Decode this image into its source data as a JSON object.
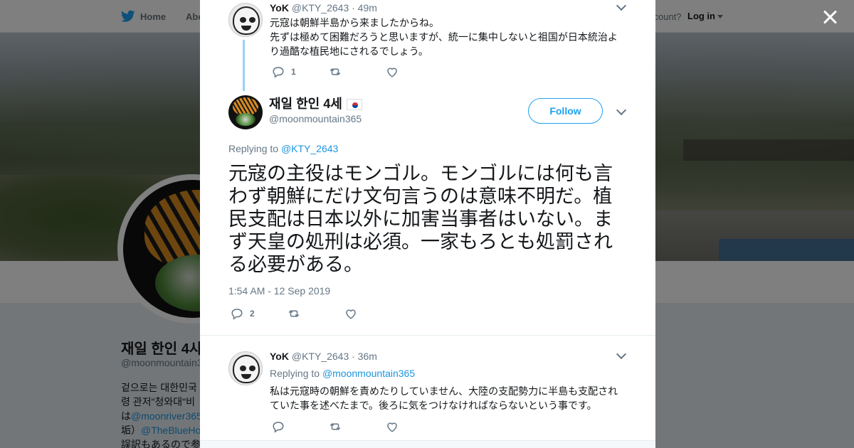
{
  "nav": {
    "home": "Home",
    "about": "Abo",
    "account_prompt": "ccount?",
    "login": "Log in"
  },
  "profile": {
    "name": "재일 한인 4사",
    "handle": "@moonmountain3",
    "bio_line1": "겉으로는 대한민국",
    "bio_line2": "령 관저\"청와대\"비",
    "bio_line3_prefix": "は",
    "bio_line3_link": "@moonriver365",
    "bio_line4_prefix": "垢）",
    "bio_line4_link": "@TheBlueHo",
    "bio_line5": "誤訳もあるので参"
  },
  "modal": {
    "close_label": "×",
    "parent_tweet": {
      "name": "YoK",
      "handle": "@KTY_2643",
      "time": "· 49m",
      "text_line1": "元寇は朝鮮半島から来ましたからね。",
      "text_line2": "先ずは極めて困難だろうと思いますが、統一に集中しないと祖国が日本統治より過酷な植民地にされるでしょう。",
      "reply_count": "1"
    },
    "main_tweet": {
      "name": "재일 한인 4세",
      "handle": "@moonmountain365",
      "follow_label": "Follow",
      "replying_prefix": "Replying to",
      "replying_to": "@KTY_2643",
      "text": "元寇の主役はモンゴル。モンゴルには何も言わず朝鮮にだけ文句言うのは意味不明だ。植民支配は日本以外に加害当事者はいない。まず天皇の処刑は必須。一家もろとも処罰される必要がある。",
      "timestamp": "1:54 AM - 12 Sep 2019",
      "reply_count": "2"
    },
    "reply_tweet": {
      "name": "YoK",
      "handle": "@KTY_2643",
      "time": "· 36m",
      "replying_prefix": "Replying to",
      "replying_to": "@moonmountain365",
      "text": "私は元寇時の朝鮮を責めたりしていません、大陸の支配勢力に半島も支配されていた事を述べたまで。後ろに気をつけなければならないという事です。"
    }
  },
  "icons": {
    "twitter_bird": "twitter-bird-icon",
    "reply": "reply-icon",
    "retweet": "retweet-icon",
    "like": "heart-icon",
    "more": "chevron-down-icon",
    "flag": "south-korea-flag-icon"
  },
  "colors": {
    "accent": "#1da1f2",
    "link": "#1b95e0",
    "thread_line": "#97d2f5",
    "muted": "#657786"
  }
}
